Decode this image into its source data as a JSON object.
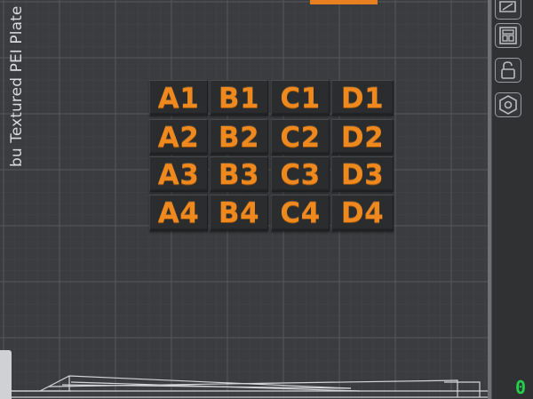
{
  "bed": {
    "plate_label": "bu Textured PEI Plate"
  },
  "tiles": [
    {
      "row": 0,
      "col": 0,
      "label": "A1"
    },
    {
      "row": 0,
      "col": 1,
      "label": "B1"
    },
    {
      "row": 0,
      "col": 2,
      "label": "C1"
    },
    {
      "row": 0,
      "col": 3,
      "label": "D1"
    },
    {
      "row": 1,
      "col": 0,
      "label": "A2"
    },
    {
      "row": 1,
      "col": 1,
      "label": "B2"
    },
    {
      "row": 1,
      "col": 2,
      "label": "C2"
    },
    {
      "row": 1,
      "col": 3,
      "label": "D2"
    },
    {
      "row": 2,
      "col": 0,
      "label": "A3"
    },
    {
      "row": 2,
      "col": 1,
      "label": "B3"
    },
    {
      "row": 2,
      "col": 2,
      "label": "C3"
    },
    {
      "row": 2,
      "col": 3,
      "label": "D3"
    },
    {
      "row": 3,
      "col": 0,
      "label": "A4"
    },
    {
      "row": 3,
      "col": 1,
      "label": "B4"
    },
    {
      "row": 3,
      "col": 2,
      "label": "C4"
    },
    {
      "row": 3,
      "col": 3,
      "label": "D4"
    }
  ],
  "toolbar": {
    "buttons": [
      {
        "name": "tool-draw-icon"
      },
      {
        "name": "arrange-layout-icon"
      },
      {
        "name": "lock-icon"
      },
      {
        "name": "settings-hex-icon"
      }
    ]
  },
  "status": {
    "value": "0"
  },
  "colors": {
    "accent": "#e9801f",
    "tile_text": "#f0891d",
    "status_green": "#22d24a",
    "bed_background": "#3b3d40"
  }
}
